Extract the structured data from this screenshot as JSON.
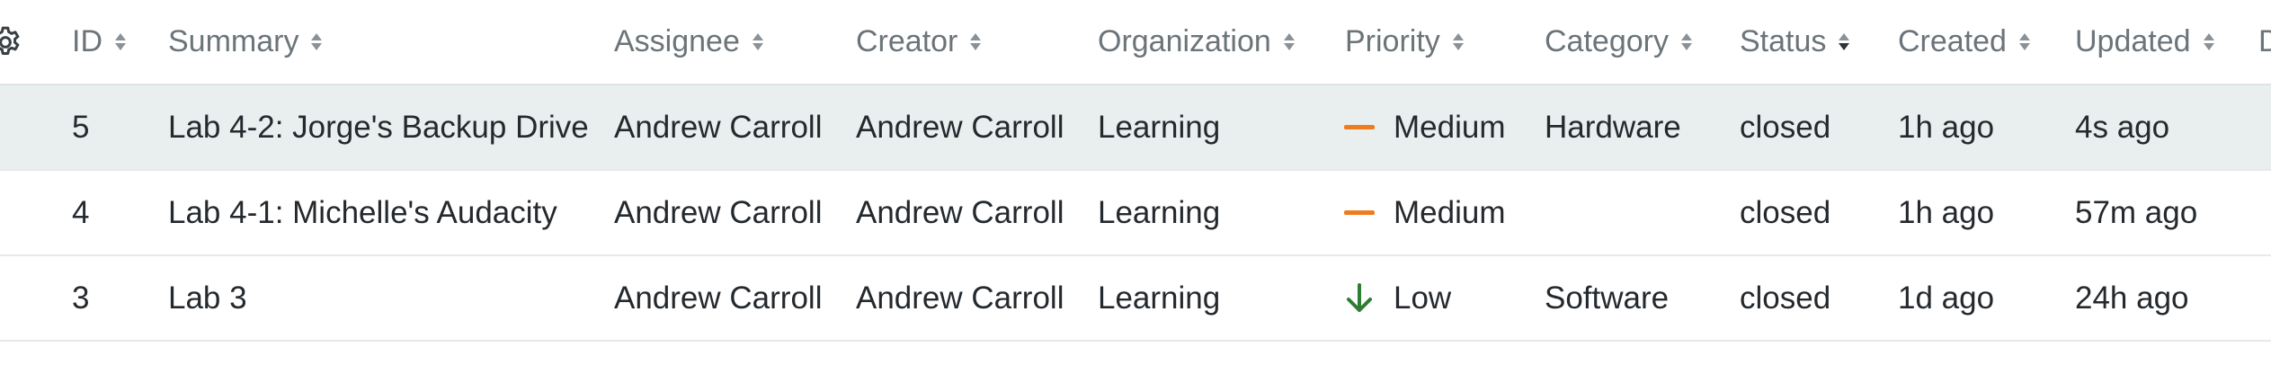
{
  "columns": {
    "id": "ID",
    "summary": "Summary",
    "assignee": "Assignee",
    "creator": "Creator",
    "organization": "Organization",
    "priority": "Priority",
    "category": "Category",
    "status": "Status",
    "created": "Created",
    "updated": "Updated",
    "overflow": "D"
  },
  "sort": {
    "column": "status",
    "direction": "desc"
  },
  "colors": {
    "medium_priority": "#ee7c1f",
    "low_priority": "#2e7d32",
    "selected_row": "#e9eeef"
  },
  "rows": [
    {
      "id": "5",
      "summary": "Lab 4-2: Jorge's Backup Drive",
      "assignee": "Andrew Carroll",
      "creator": "Andrew Carroll",
      "organization": "Learning",
      "priority": "Medium",
      "priority_icon": "dash-icon",
      "category": "Hardware",
      "status": "closed",
      "created": "1h ago",
      "updated": "4s ago"
    },
    {
      "id": "4",
      "summary": "Lab 4-1: Michelle's Audacity",
      "assignee": "Andrew Carroll",
      "creator": "Andrew Carroll",
      "organization": "Learning",
      "priority": "Medium",
      "priority_icon": "dash-icon",
      "category": "",
      "status": "closed",
      "created": "1h ago",
      "updated": "57m ago"
    },
    {
      "id": "3",
      "summary": "Lab 3",
      "assignee": "Andrew Carroll",
      "creator": "Andrew Carroll",
      "organization": "Learning",
      "priority": "Low",
      "priority_icon": "arrow-down-icon",
      "category": "Software",
      "status": "closed",
      "created": "1d ago",
      "updated": "24h ago"
    }
  ]
}
